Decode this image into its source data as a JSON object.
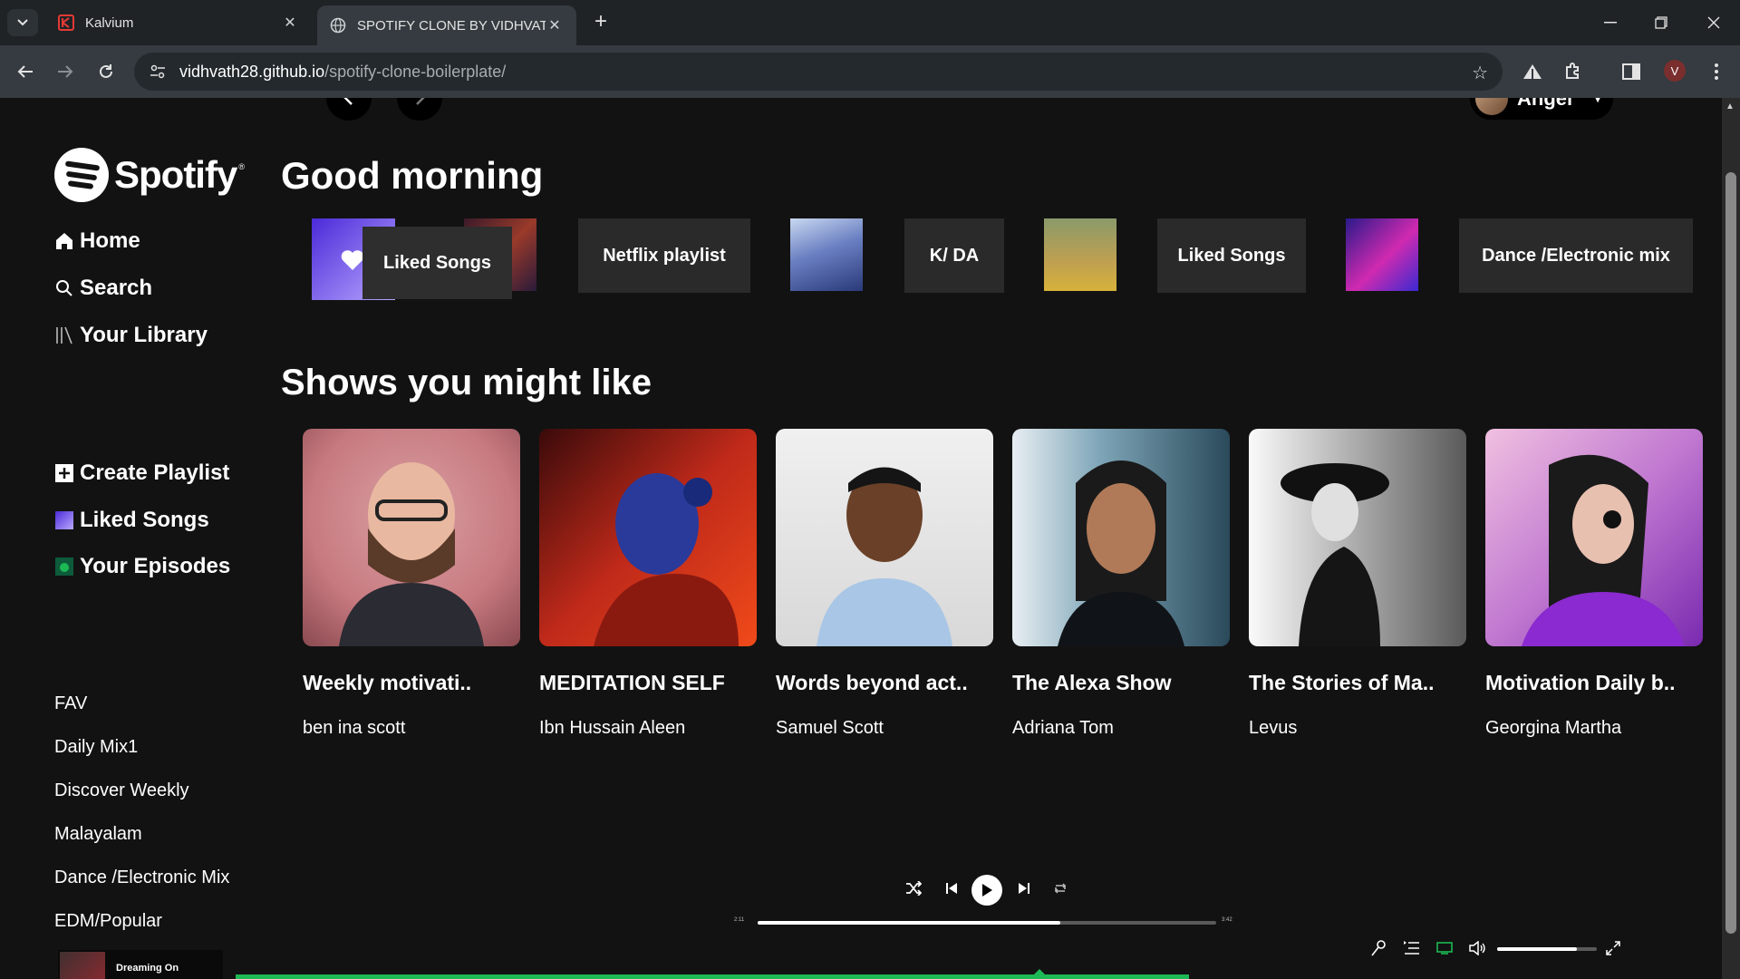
{
  "browser": {
    "tabs": [
      {
        "title": "Kalvium",
        "active": false
      },
      {
        "title": "SPOTIFY CLONE BY VIDHVATH J",
        "active": true
      }
    ],
    "url_host": "vidhvath28.github.io",
    "url_path": "/spotify-clone-boilerplate/",
    "profile_initial": "V"
  },
  "user": {
    "name": "Angel"
  },
  "brand": {
    "name": "Spotify",
    "mark": "®"
  },
  "sidebar": {
    "nav": [
      "Home",
      "Search",
      "Your Library"
    ],
    "actions": [
      "Create Playlist",
      "Liked Songs",
      "Your Episodes"
    ],
    "playlists": [
      "FAV",
      "Daily Mix1",
      "Discover Weekly",
      "Malayalam",
      "Dance /Electronic Mix",
      "EDM/Popular"
    ],
    "now_playing": "Dreaming On"
  },
  "main": {
    "greeting": "Good morning",
    "quick_tiles": [
      "Liked Songs",
      "Netflix playlist",
      "K/ DA",
      "Liked Songs",
      "Dance /Electronic mix"
    ],
    "shows_heading": "Shows you might like",
    "shows": [
      {
        "title": "Weekly motivati..",
        "author": "ben ina scott"
      },
      {
        "title": "MEDITATION SELF",
        "author": "Ibn Hussain Aleen"
      },
      {
        "title": "Words beyond act..",
        "author": "Samuel Scott"
      },
      {
        "title": "The Alexa Show",
        "author": "Adriana Tom"
      },
      {
        "title": "The Stories of Ma..",
        "author": "Levus"
      },
      {
        "title": "Motivation Daily b..",
        "author": "Georgina Martha"
      }
    ]
  },
  "player": {
    "time_elapsed": "2:11",
    "time_total": "3:42",
    "progress": 0.66,
    "volume": 0.8
  },
  "colors": {
    "accent": "#1db954",
    "background": "#121212",
    "tile": "#2a2a2a"
  }
}
